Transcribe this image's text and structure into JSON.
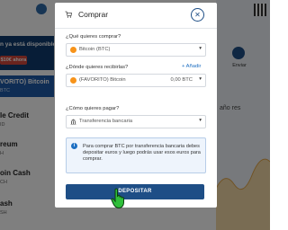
{
  "background": {
    "promo_text": "n ya está disponible!",
    "promo_button": "$10€ ahora",
    "selected_coin_name": "VORITO) Bitcoin",
    "selected_coin_sub": "BTC",
    "coins": [
      {
        "name": "le Credit",
        "sub": "ID"
      },
      {
        "name": "reum",
        "sub": "H"
      },
      {
        "name": "oin Cash",
        "sub": "CH"
      },
      {
        "name": "ash",
        "sub": "SH"
      }
    ],
    "send_label": "Enviar",
    "tabs_label": "año   res",
    "colors": {
      "promo": "#0e3a6e",
      "selected": "#1e5aa8",
      "chart": "#f3d9a6"
    }
  },
  "modal": {
    "title": "Comprar",
    "title_icon": "cart-icon",
    "close_icon": "close-icon",
    "q1_label": "¿Qué quieres comprar?",
    "q1_value": "Bitcoin (BTC)",
    "q2_label": "¿Dónde quieres recibirlas?",
    "q2_add": "+ Añadir",
    "q2_value": "(FAVORITO) Bitcoin",
    "q2_amount": "0,00 BTC",
    "q3_label": "¿Cómo quieres pagar?",
    "q3_value": "Transferencia bancaria",
    "info_text": "Para comprar BTC por transferencia bancaria debes depositar euros y luego podrás usar esos euros para comprar.",
    "deposit_label": "DEPOSITAR",
    "colors": {
      "primary": "#1e4e86",
      "bitcoin": "#f7931a",
      "info_bg": "#eef4fc"
    }
  }
}
